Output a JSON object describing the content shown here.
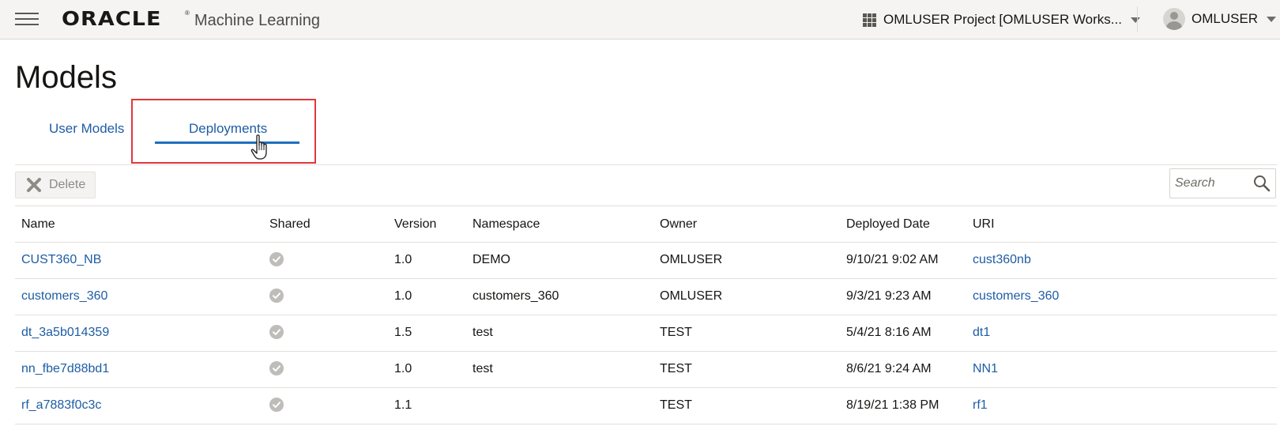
{
  "header": {
    "logo_text": "ORACLE",
    "registered_mark": "®",
    "product": "Machine Learning",
    "project_label": "OMLUSER Project [OMLUSER Works...",
    "user_label": "OMLUSER",
    "icons": [
      "hamburger-menu-icon",
      "grid-icon",
      "chevron-down-icon",
      "avatar-icon"
    ]
  },
  "page": {
    "title": "Models",
    "tabs": [
      {
        "label": "User Models",
        "selected": false
      },
      {
        "label": "Deployments",
        "selected": true
      }
    ]
  },
  "toolbar": {
    "delete_label": "Delete",
    "search_placeholder": "Search"
  },
  "table": {
    "columns": [
      "Name",
      "Shared",
      "Version",
      "Namespace",
      "Owner",
      "Deployed Date",
      "URI"
    ],
    "rows": [
      {
        "name": "CUST360_NB",
        "shared": true,
        "version": "1.0",
        "namespace": "DEMO",
        "owner": "OMLUSER",
        "deployed_date": "9/10/21 9:02 AM",
        "uri": "cust360nb"
      },
      {
        "name": "customers_360",
        "shared": true,
        "version": "1.0",
        "namespace": "customers_360",
        "owner": "OMLUSER",
        "deployed_date": "9/3/21 9:23 AM",
        "uri": "customers_360"
      },
      {
        "name": "dt_3a5b014359",
        "shared": true,
        "version": "1.5",
        "namespace": "test",
        "owner": "TEST",
        "deployed_date": "5/4/21 8:16 AM",
        "uri": "dt1"
      },
      {
        "name": "nn_fbe7d88bd1",
        "shared": true,
        "version": "1.0",
        "namespace": "test",
        "owner": "TEST",
        "deployed_date": "8/6/21 9:24 AM",
        "uri": "NN1"
      },
      {
        "name": "rf_a7883f0c3c",
        "shared": true,
        "version": "1.1",
        "namespace": "",
        "owner": "TEST",
        "deployed_date": "8/19/21 1:38 PM",
        "uri": "rf1"
      }
    ]
  },
  "colors": {
    "link": "#1e5da4",
    "tab_underline": "#1e6fbf",
    "highlight_box": "#e2373c",
    "topbar_bg": "#f5f4f2"
  }
}
